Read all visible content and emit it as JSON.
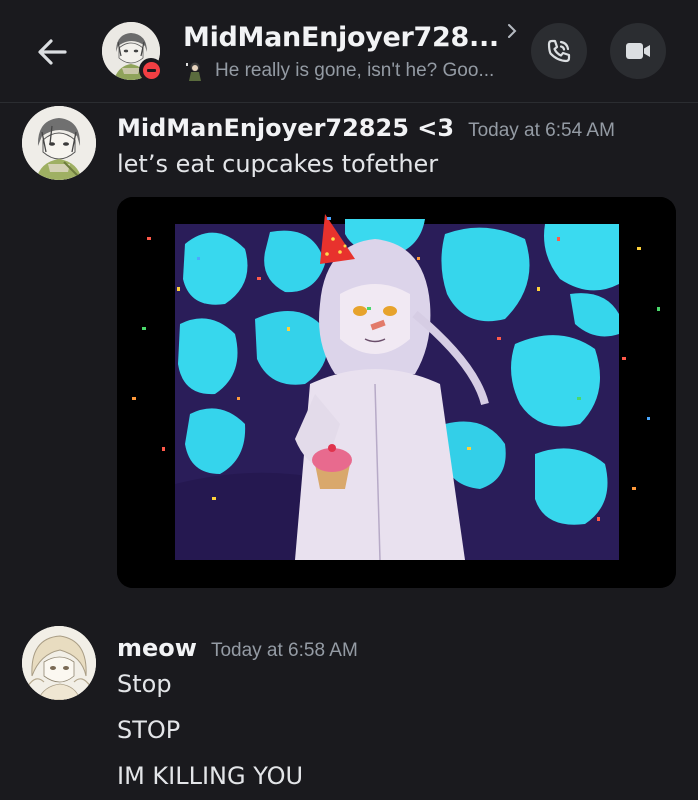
{
  "header": {
    "title": "MidManEnjoyer728...",
    "status_text": "He really is gone, isn't he? Goo...",
    "icons": {
      "back": "arrow-left-icon",
      "chevron": "chevron-right-icon",
      "call": "phone-call-icon",
      "video": "video-camera-icon",
      "status": "do-not-disturb-icon"
    },
    "colors": {
      "status_dnd": "#f23f43"
    }
  },
  "messages": [
    {
      "author": "MidManEnjoyer72825 <3",
      "timestamp": "Today at 6:54 AM",
      "lines": [
        "let’s eat cupcakes tofether"
      ],
      "has_image": true
    },
    {
      "author": "meow",
      "timestamp": "Today at 6:58 AM",
      "lines": [
        "Stop",
        "STOP",
        "IM KILLING YOU"
      ]
    }
  ],
  "colors": {
    "background": "#1a1a1e",
    "button_bg": "#2b2d31",
    "image_cyan": "#35d9ef",
    "image_purple": "#2c1f5c"
  }
}
